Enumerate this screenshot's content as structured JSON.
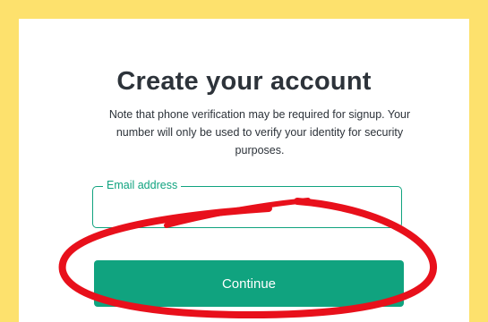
{
  "signup": {
    "title": "Create your account",
    "note": "Note that phone verification may be required for signup. Your number will only be used to verify your identity for security purposes.",
    "email": {
      "label": "Email address",
      "value": "",
      "placeholder": ""
    },
    "continue_label": "Continue"
  },
  "colors": {
    "frame": "#fde16d",
    "accent": "#10a37f",
    "text": "#2d333a",
    "annotation": "#e8101b"
  }
}
